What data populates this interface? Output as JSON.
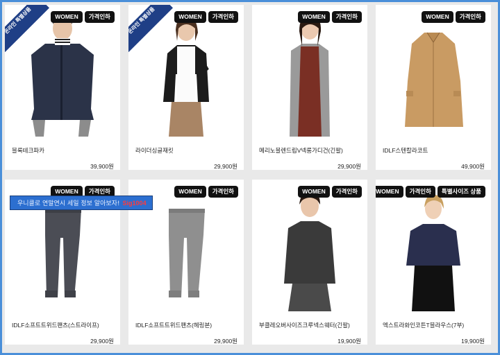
{
  "products": [
    {
      "name": "블록테크파카",
      "price": "39,900원",
      "badges": [
        "WOMEN",
        "가격인하"
      ],
      "ribbon": "온라인 특별상품"
    },
    {
      "name": "라이더싱글재킷",
      "price": "29,900원",
      "badges": [
        "WOMEN",
        "가격인하"
      ],
      "ribbon": "온라인 특별상품"
    },
    {
      "name": "메리노블렌드립V넥롱가디건(긴팔)",
      "price": "29,900원",
      "badges": [
        "WOMEN",
        "가격인하"
      ]
    },
    {
      "name": "IDLF스텐칼라코트",
      "price": "49,900원",
      "badges": [
        "WOMEN",
        "가격인하"
      ]
    },
    {
      "name": "IDLF소프트트위드팬츠(스트라이프)",
      "price": "29,900원",
      "badges": [
        "WOMEN",
        "가격인하"
      ]
    },
    {
      "name": "IDLF소프트트위드팬츠(헤링본)",
      "price": "29,900원",
      "badges": [
        "WOMEN",
        "가격인하"
      ]
    },
    {
      "name": "부클레오버사이즈크루넥스웨터(긴팔)",
      "price": "19,900원",
      "badges": [
        "WOMEN",
        "가격인하"
      ]
    },
    {
      "name": "엑스트라화인코튼T블라우스(7부)",
      "price": "19,900원",
      "badges": [
        "WOMEN",
        "가격인하",
        "특별사이즈 상품"
      ]
    }
  ],
  "watermark": {
    "text": "우니클로 연말연시 세일 정보 알아보자!",
    "signature": "Sig1004"
  }
}
